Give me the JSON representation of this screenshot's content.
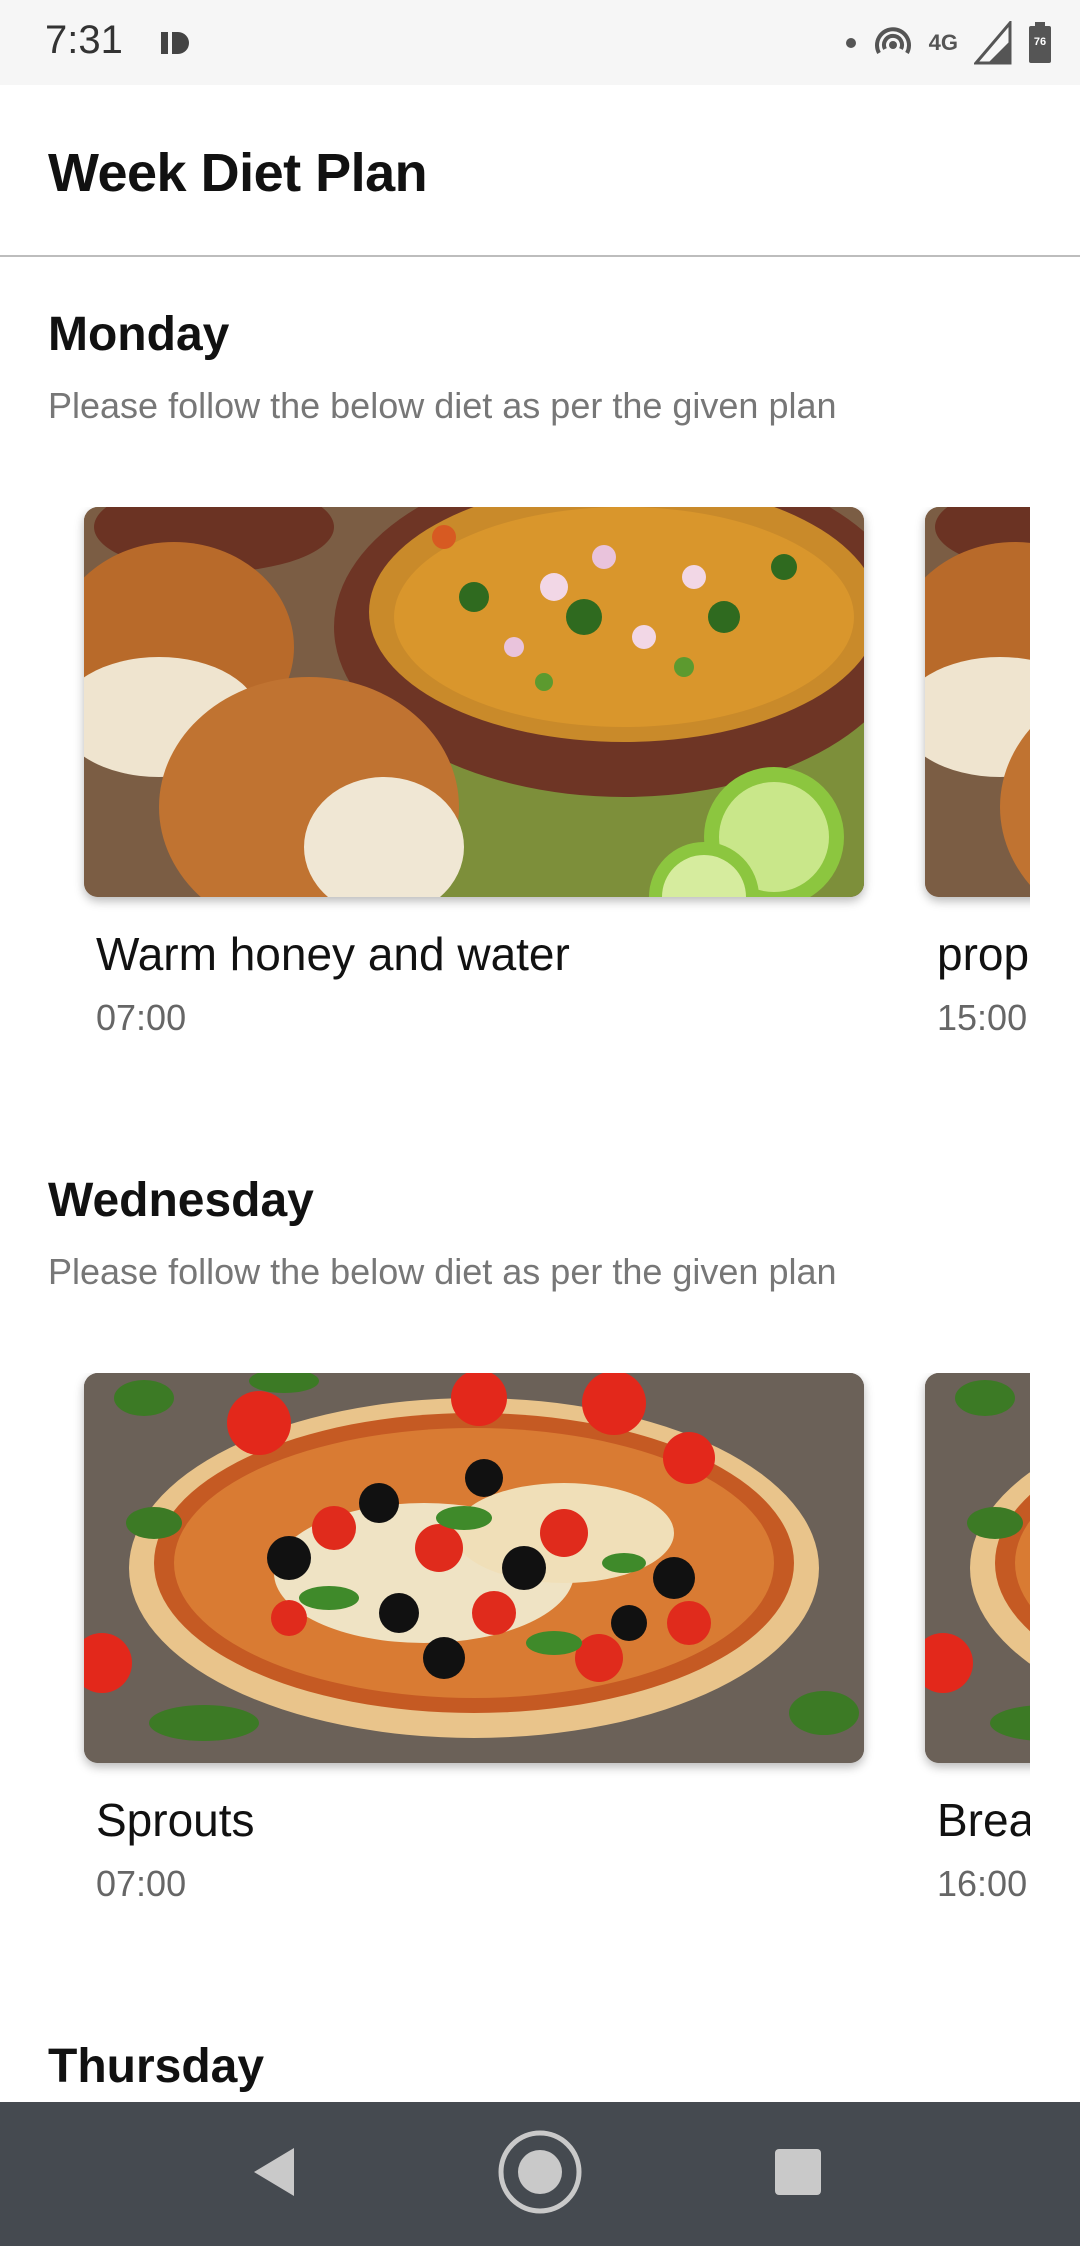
{
  "status_bar": {
    "time": "7:31",
    "left_icon": "data-saver-icon",
    "network_label": "4G",
    "battery_level": "76",
    "icons": [
      "notification-dot-icon",
      "hotspot-icon",
      "signal-icon",
      "battery-icon"
    ]
  },
  "app_bar": {
    "title": "Week Diet Plan"
  },
  "days": [
    {
      "day": "Monday",
      "subtitle": "Please follow the below diet as per the given plan",
      "items": [
        {
          "title": "Warm honey and water",
          "time": "07:00",
          "image": "curry-with-buns-photo"
        },
        {
          "title": "prop",
          "time": "15:00",
          "image": "curry-with-buns-photo"
        }
      ]
    },
    {
      "day": "Wednesday",
      "subtitle": "Please follow the below diet as per the given plan",
      "items": [
        {
          "title": "Sprouts",
          "time": "07:00",
          "image": "pizza-photo"
        },
        {
          "title": "Brea",
          "time": "16:00",
          "image": "pizza-photo"
        }
      ]
    },
    {
      "day": "Thursday",
      "subtitle": "",
      "items": []
    }
  ],
  "nav_bar": {
    "buttons": [
      "back-icon",
      "home-icon",
      "recents-icon"
    ]
  },
  "colors": {
    "status_bar_bg": "#f6f6f6",
    "nav_bar_bg": "#454a50",
    "subtitle_text": "#777777",
    "divider": "#bdbdbd"
  }
}
